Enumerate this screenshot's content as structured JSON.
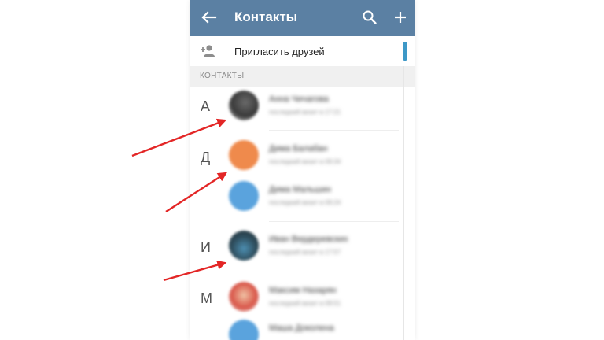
{
  "header": {
    "title": "Контакты",
    "icons": [
      "back-arrow-icon",
      "search-icon",
      "add-icon"
    ],
    "color": "#5b80a3"
  },
  "invite": {
    "label": "Пригласить друзей",
    "icon": "add-person-icon"
  },
  "section_label": "КОНТАКТЫ",
  "letters": [
    "А",
    "Д",
    "И",
    "М"
  ],
  "contacts": [
    {
      "name": "Анна Чичагова",
      "status": "последний визит в 17:21"
    },
    {
      "name": "Дима Балабан",
      "status": "последний визит в 09:34"
    },
    {
      "name": "Дима Мальшин",
      "status": "последний визит в 09:24"
    },
    {
      "name": "Иван Вердеревских",
      "status": "последний визит в 17:57"
    },
    {
      "name": "Максим Назарян",
      "status": "последний визит в 09:51"
    },
    {
      "name": "Маша Доколена",
      "status": ""
    }
  ],
  "annotation_color": "#e32626"
}
